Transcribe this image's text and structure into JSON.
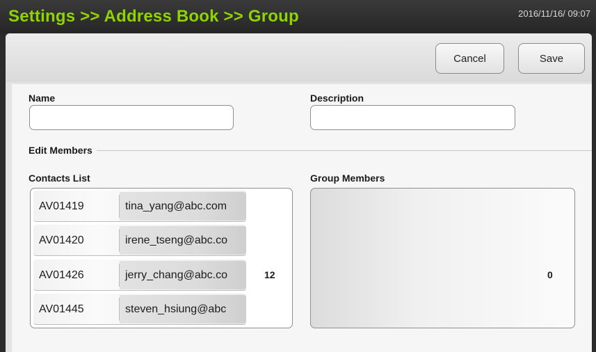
{
  "header": {
    "title": "Settings >> Address Book >> Group",
    "datetime": "2016/11/16/ 09:07",
    "accent_color": "#8fd400"
  },
  "toolbar": {
    "cancel_label": "Cancel",
    "save_label": "Save"
  },
  "form": {
    "name_label": "Name",
    "name_value": "",
    "description_label": "Description",
    "description_value": "",
    "edit_members_label": "Edit Members"
  },
  "contacts": {
    "label": "Contacts List",
    "count": "12",
    "items": [
      {
        "id": "AV01419",
        "email": "tina_yang@abc.com"
      },
      {
        "id": "AV01420",
        "email": "irene_tseng@abc.co"
      },
      {
        "id": "AV01426",
        "email": "jerry_chang@abc.co"
      },
      {
        "id": "AV01445",
        "email": "steven_hsiung@abc"
      }
    ]
  },
  "group_members": {
    "label": "Group Members",
    "count": "0",
    "items": []
  }
}
